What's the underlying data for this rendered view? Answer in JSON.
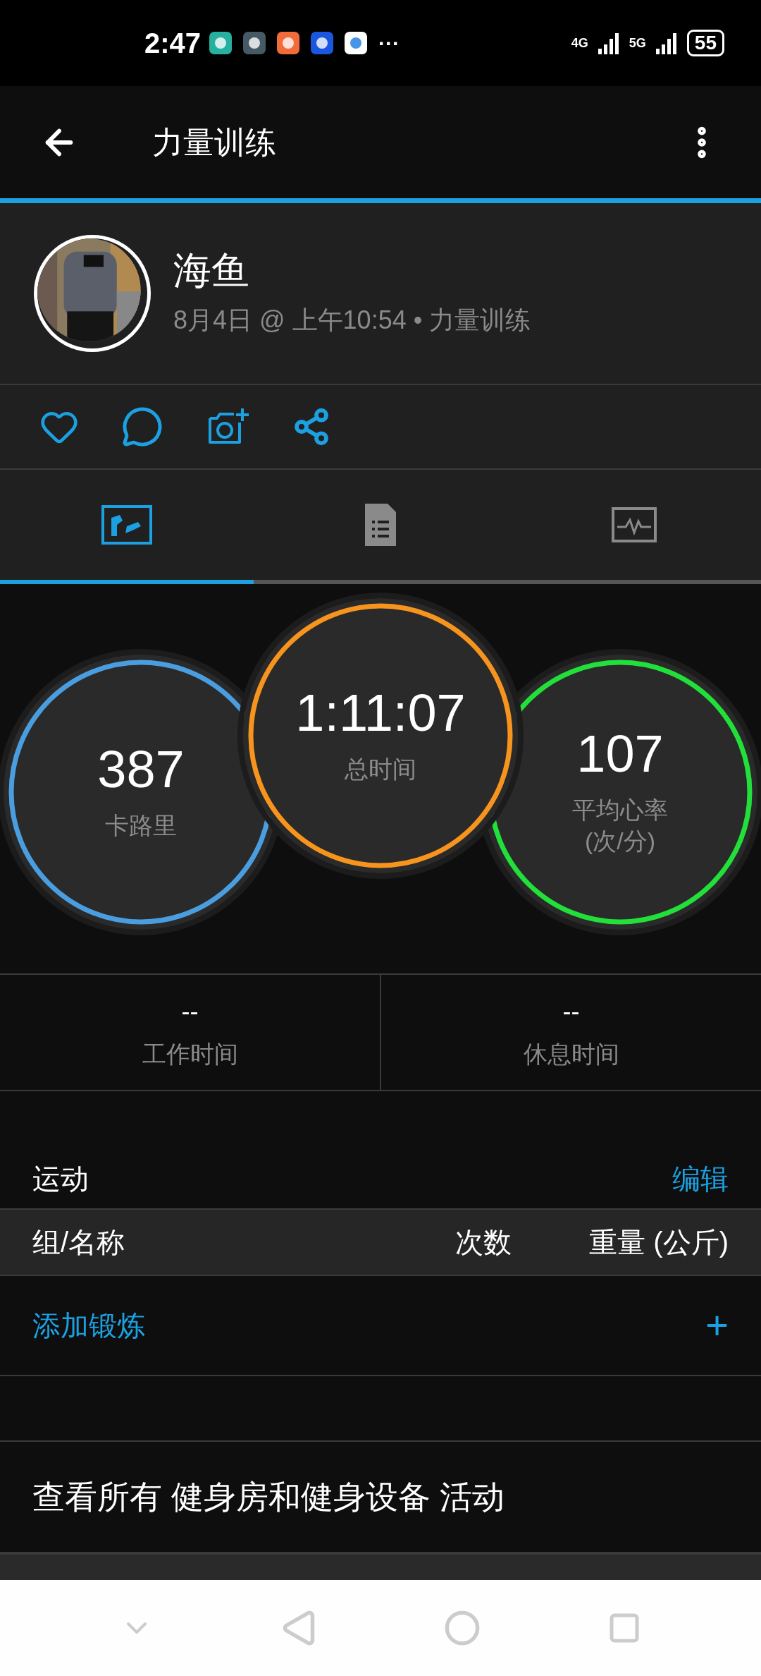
{
  "status_bar": {
    "time": "2:47",
    "more": "···",
    "battery": "55",
    "net1": "4G",
    "net2": "5G"
  },
  "header": {
    "title": "力量训练"
  },
  "profile": {
    "name": "海鱼",
    "meta": "8月4日 @ 上午10:54 • 力量训练"
  },
  "tabs": [
    {
      "kind": "overview",
      "selected": true
    },
    {
      "kind": "details",
      "selected": false
    },
    {
      "kind": "chart",
      "selected": false
    }
  ],
  "metrics": [
    {
      "value": "387",
      "label": "卡路里",
      "color": "#4a9ee0"
    },
    {
      "value": "1:11:07",
      "label": "总时间",
      "color": "#f7941d"
    },
    {
      "value": "107",
      "label": "平均心率\n(次/分)",
      "color": "#22e03a"
    }
  ],
  "stats": [
    {
      "value": "--",
      "label": "工作时间"
    },
    {
      "value": "--",
      "label": "休息时间"
    }
  ],
  "exercises": {
    "title": "运动",
    "edit": "编辑",
    "columns": [
      "组/名称",
      "次数",
      "重量 (公斤)"
    ],
    "add": "添加锻炼",
    "add_icon": "+"
  },
  "view_all": "查看所有 健身房和健身设备 活动"
}
